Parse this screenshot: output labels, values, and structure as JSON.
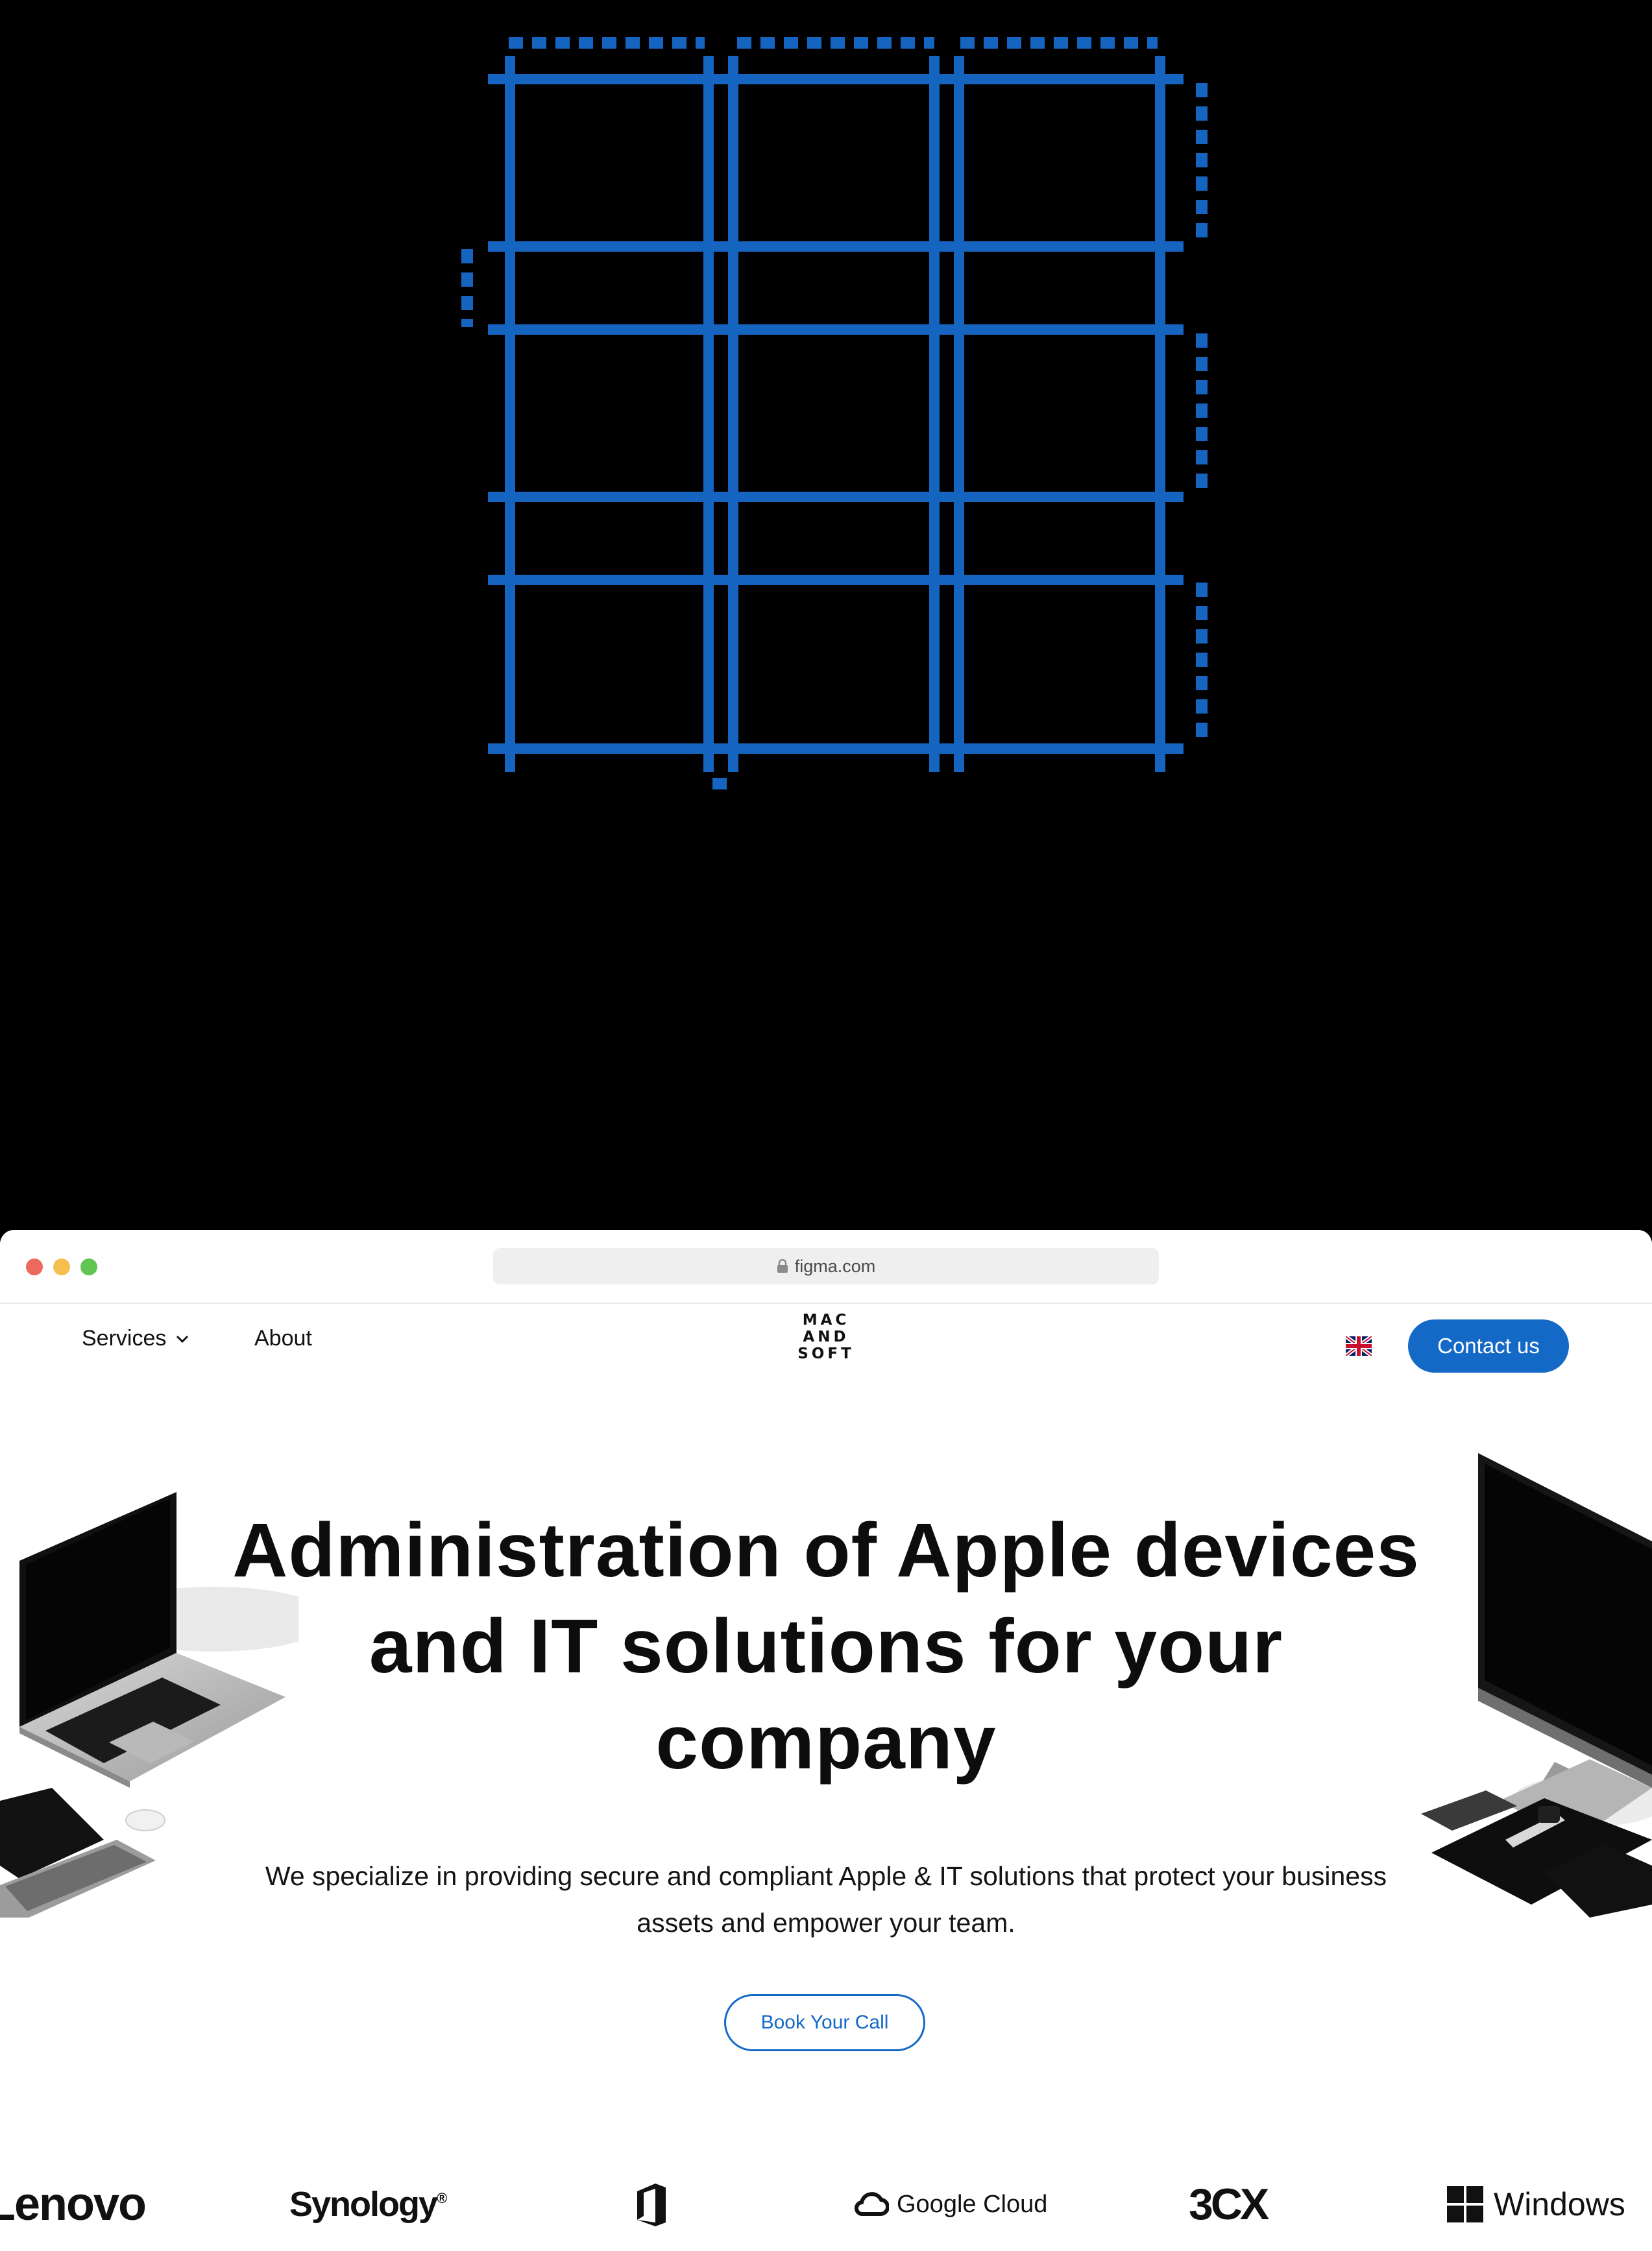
{
  "browser": {
    "url": "figma.com"
  },
  "nav": {
    "services_label": "Services",
    "about_label": "About",
    "logo_lines": [
      "MAC",
      "AND",
      "SOFT"
    ],
    "contact_label": "Contact us"
  },
  "hero": {
    "title_lines": [
      "Administration of Apple devices",
      "and IT solutions for your",
      "company"
    ],
    "subtitle_lines": [
      "We specialize in providing secure and compliant Apple & IT solutions that protect your business",
      "assets and empower your team."
    ],
    "cta_label": "Book Your Call"
  },
  "brands": {
    "lenovo": "Lenovo",
    "synology": "Synology",
    "synology_mark": "®",
    "google_cloud": "Google Cloud",
    "threecx": "3CX",
    "windows": "Windows"
  },
  "colors": {
    "accent": "#1469c7",
    "blueprint": "#1565c0",
    "background_top": "#000000",
    "page": "#ffffff"
  },
  "icons": {
    "lock": "lock-icon",
    "chevron": "chevron-down-icon",
    "flag": "uk-flag-icon",
    "office": "office-icon",
    "google_cloud": "google-cloud-icon",
    "windows": "windows-icon"
  }
}
